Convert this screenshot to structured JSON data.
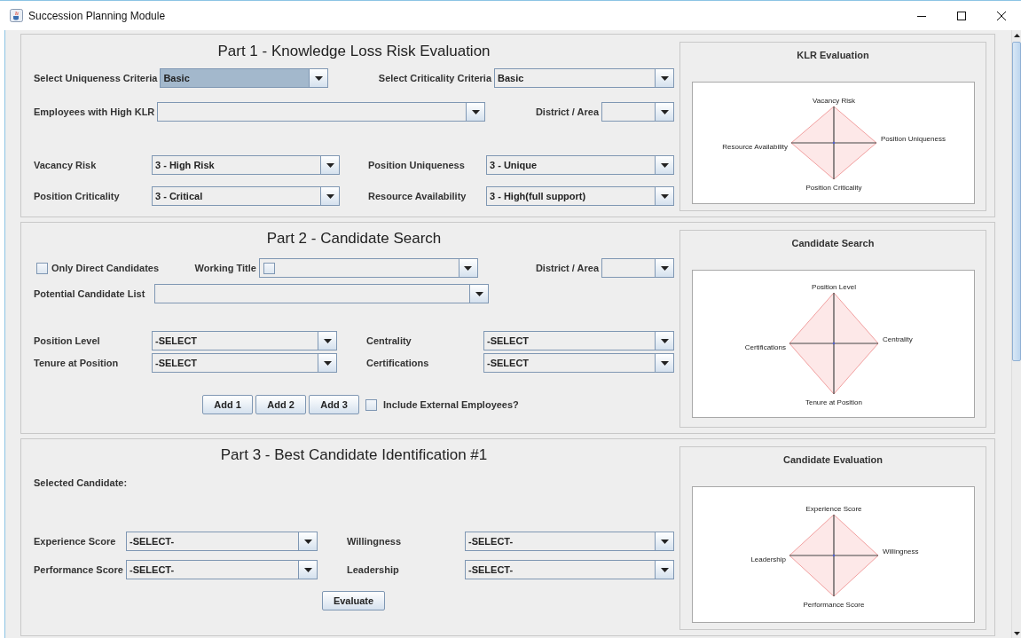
{
  "window": {
    "title": "Succession Planning Module"
  },
  "part1": {
    "title": "Part 1 - Knowledge Loss Risk Evaluation",
    "uniqueness_criteria": {
      "label": "Select Uniqueness Criteria",
      "value": "Basic",
      "focused": true
    },
    "criticality_criteria": {
      "label": "Select Criticality Criteria",
      "value": "Basic",
      "focused": false
    },
    "employees_high_klr": {
      "label": "Employees with High KLR",
      "focused": false
    },
    "district_area": {
      "label": "District / Area",
      "focused": false
    },
    "vacancy_risk": {
      "label": "Vacancy Risk",
      "value": "3 - High Risk",
      "focused": false
    },
    "position_uniqueness": {
      "label": "Position Uniqueness",
      "value": "3 - Unique",
      "focused": false
    },
    "position_criticality": {
      "label": "Position Criticality",
      "value": "3 - Critical",
      "focused": false
    },
    "resource_availability": {
      "label": "Resource Availability",
      "value": "3 - High(full support)",
      "focused": false
    },
    "chart": {
      "title": "KLR Evaluation",
      "axes": {
        "top": "Vacancy Risk",
        "right": "Position Uniqueness",
        "bottom": "Position Criticality",
        "left": "Resource Availability"
      }
    }
  },
  "part2": {
    "title": "Part 2 - Candidate Search",
    "only_direct": {
      "label": "Only Direct Candidates",
      "checked": false
    },
    "working_title": {
      "label": "Working Title",
      "focused": false,
      "checkbox": {
        "checked": false
      }
    },
    "district_area": {
      "label": "District / Area",
      "focused": false
    },
    "potential_candidates": {
      "label": "Potential Candidate List",
      "focused": false
    },
    "position_level": {
      "label": "Position Level",
      "value": "-SELECT",
      "focused": false
    },
    "centrality": {
      "label": "Centrality",
      "value": "-SELECT",
      "focused": false
    },
    "tenure": {
      "label": "Tenure at Position",
      "value": "-SELECT",
      "focused": false
    },
    "certifications": {
      "label": "Certifications",
      "value": "-SELECT",
      "focused": false
    },
    "buttons": [
      "Add 1",
      "Add 2",
      "Add 3"
    ],
    "include_external": {
      "label": "Include External Employees?",
      "checked": false
    },
    "chart": {
      "title": "Candidate Search",
      "axes": {
        "top": "Position Level",
        "right": "Centrality",
        "bottom": "Tenure at Position",
        "left": "Certifications"
      }
    }
  },
  "part3": {
    "title": "Part 3 - Best Candidate Identification #1",
    "selected_candidate": {
      "label": "Selected Candidate:"
    },
    "experience": {
      "label": "Experience Score",
      "value": "-SELECT-",
      "focused": false
    },
    "willingness": {
      "label": "Willingness",
      "value": "-SELECT-",
      "focused": false
    },
    "performance": {
      "label": "Performance Score",
      "value": "-SELECT-",
      "focused": false
    },
    "leadership": {
      "label": "Leadership",
      "value": "-SELECT-",
      "focused": false
    },
    "evaluate_button": "Evaluate",
    "chart": {
      "title": "Candidate Evaluation",
      "axes": {
        "top": "Experience Score",
        "right": "Willingness",
        "bottom": "Performance Score",
        "left": "Leadership"
      }
    }
  }
}
